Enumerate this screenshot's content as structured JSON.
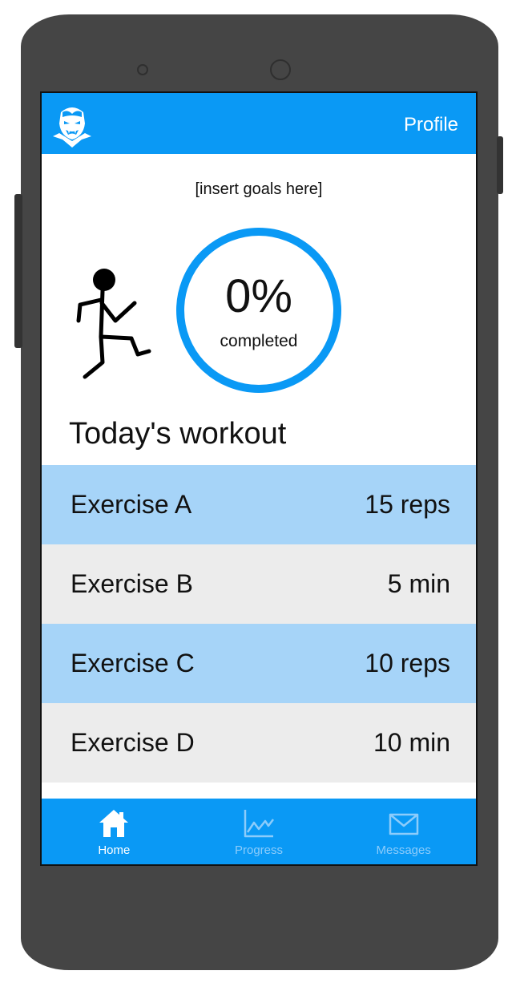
{
  "header": {
    "logo_icon": "vampire-face-icon",
    "profile_label": "Profile"
  },
  "goals_text": "[insert goals here]",
  "progress": {
    "percent": 0,
    "value_text": "0%",
    "label": "completed"
  },
  "illustration_icon": "running-stick-figure-icon",
  "workout": {
    "title": "Today's workout",
    "exercises": [
      {
        "name": "Exercise A",
        "amount": "15 reps"
      },
      {
        "name": "Exercise B",
        "amount": "5 min"
      },
      {
        "name": "Exercise C",
        "amount": "10 reps"
      },
      {
        "name": "Exercise D",
        "amount": "10 min"
      }
    ]
  },
  "tabs": [
    {
      "label": "Home",
      "icon": "home-icon",
      "active": true
    },
    {
      "label": "Progress",
      "icon": "line-chart-icon",
      "active": false
    },
    {
      "label": "Messages",
      "icon": "envelope-icon",
      "active": false
    }
  ],
  "colors": {
    "primary": "#0a99f5",
    "row_highlight": "#a6d4f8",
    "row_neutral": "#ececec",
    "tab_inactive": "#8cccfb",
    "device_frame": "#454545"
  }
}
